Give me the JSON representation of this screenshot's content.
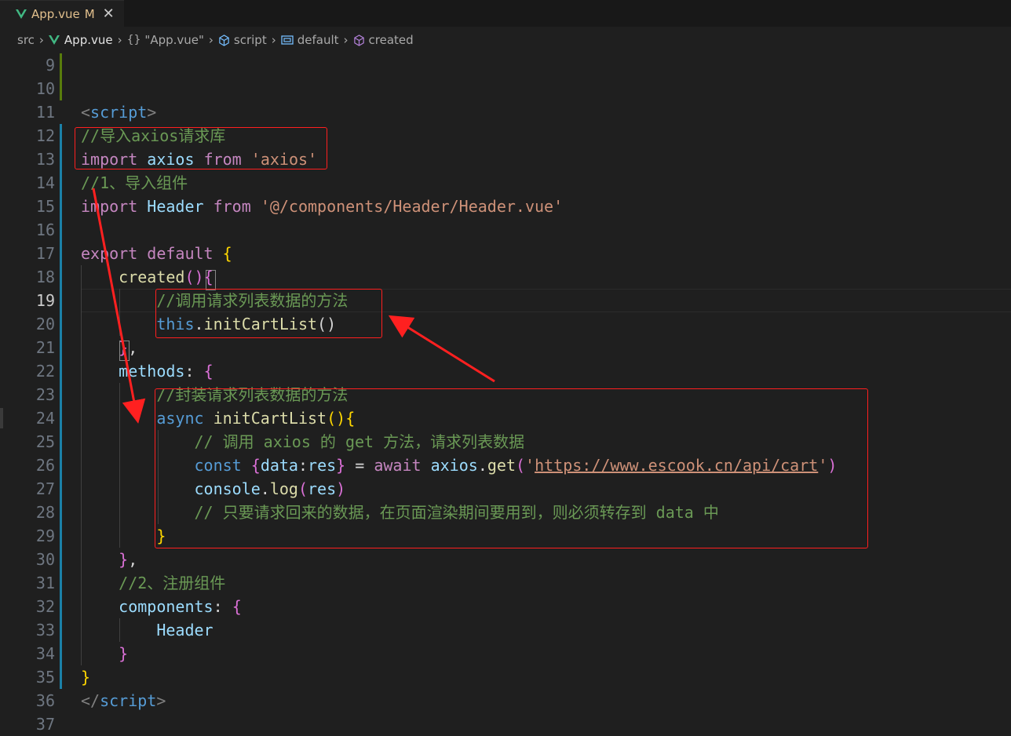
{
  "tab": {
    "filename": "App.vue",
    "status": "M",
    "icon": "vue-icon"
  },
  "breadcrumb": [
    {
      "label": "src",
      "icon": ""
    },
    {
      "label": "App.vue",
      "icon": "vue-icon"
    },
    {
      "label": "\"App.vue\"",
      "icon": "braces-icon"
    },
    {
      "label": "script",
      "icon": "cube-icon"
    },
    {
      "label": "default",
      "icon": "field-icon"
    },
    {
      "label": "created",
      "icon": "cube-icon"
    }
  ],
  "editor": {
    "active_line": 19,
    "lines": [
      {
        "n": "9",
        "tokens": []
      },
      {
        "n": "10",
        "tokens": []
      },
      {
        "n": "11",
        "tokens": [
          {
            "t": "<",
            "c": "tag"
          },
          {
            "t": "script",
            "c": "tagn"
          },
          {
            "t": ">",
            "c": "tag"
          }
        ]
      },
      {
        "n": "12",
        "tokens": [
          {
            "t": "//导入axios请求库",
            "c": "cm"
          }
        ]
      },
      {
        "n": "13",
        "tokens": [
          {
            "t": "import",
            "c": "kw"
          },
          {
            "t": " "
          },
          {
            "t": "axios",
            "c": "var"
          },
          {
            "t": " "
          },
          {
            "t": "from",
            "c": "kw"
          },
          {
            "t": " "
          },
          {
            "t": "'axios'",
            "c": "str"
          }
        ]
      },
      {
        "n": "14",
        "tokens": [
          {
            "t": "//1、导入组件",
            "c": "cm"
          }
        ]
      },
      {
        "n": "15",
        "tokens": [
          {
            "t": "import",
            "c": "kw"
          },
          {
            "t": " "
          },
          {
            "t": "Header",
            "c": "var"
          },
          {
            "t": " "
          },
          {
            "t": "from",
            "c": "kw"
          },
          {
            "t": " "
          },
          {
            "t": "'@/components/Header/Header.vue'",
            "c": "str"
          }
        ]
      },
      {
        "n": "16",
        "tokens": []
      },
      {
        "n": "17",
        "tokens": [
          {
            "t": "export",
            "c": "kw"
          },
          {
            "t": " "
          },
          {
            "t": "default",
            "c": "kw"
          },
          {
            "t": " "
          },
          {
            "t": "{",
            "c": "br1"
          }
        ]
      },
      {
        "n": "18",
        "tokens": [
          {
            "t": "    "
          },
          {
            "t": "created",
            "c": "fn"
          },
          {
            "t": "()",
            "c": "br2"
          },
          {
            "t": "{",
            "c": "br2"
          }
        ]
      },
      {
        "n": "19",
        "tokens": [
          {
            "t": "        "
          },
          {
            "t": "//调用请求列表数据的方法",
            "c": "cm"
          }
        ]
      },
      {
        "n": "20",
        "tokens": [
          {
            "t": "        "
          },
          {
            "t": "this",
            "c": "vb"
          },
          {
            "t": "."
          },
          {
            "t": "initCartList",
            "c": "fn"
          },
          {
            "t": "()"
          }
        ]
      },
      {
        "n": "21",
        "tokens": [
          {
            "t": "    "
          },
          {
            "t": "}",
            "c": "br2"
          },
          {
            "t": ","
          }
        ]
      },
      {
        "n": "22",
        "tokens": [
          {
            "t": "    "
          },
          {
            "t": "methods",
            "c": "var"
          },
          {
            "t": ": "
          },
          {
            "t": "{",
            "c": "br2"
          }
        ]
      },
      {
        "n": "23",
        "tokens": [
          {
            "t": "        "
          },
          {
            "t": "//封装请求列表数据的方法",
            "c": "cm"
          }
        ]
      },
      {
        "n": "24",
        "tokens": [
          {
            "t": "        "
          },
          {
            "t": "async",
            "c": "vb"
          },
          {
            "t": " "
          },
          {
            "t": "initCartList",
            "c": "fn"
          },
          {
            "t": "()",
            "c": "br1"
          },
          {
            "t": "{",
            "c": "br1"
          }
        ]
      },
      {
        "n": "25",
        "tokens": [
          {
            "t": "            "
          },
          {
            "t": "// 调用 axios 的 get 方法，请求列表数据",
            "c": "cm"
          }
        ]
      },
      {
        "n": "26",
        "tokens": [
          {
            "t": "            "
          },
          {
            "t": "const",
            "c": "vb"
          },
          {
            "t": " "
          },
          {
            "t": "{",
            "c": "br2"
          },
          {
            "t": "data",
            "c": "var"
          },
          {
            "t": ":"
          },
          {
            "t": "res",
            "c": "var"
          },
          {
            "t": "}",
            "c": "br2"
          },
          {
            "t": " = "
          },
          {
            "t": "await",
            "c": "kw"
          },
          {
            "t": " "
          },
          {
            "t": "axios",
            "c": "var"
          },
          {
            "t": "."
          },
          {
            "t": "get",
            "c": "fn"
          },
          {
            "t": "(",
            "c": "br2"
          },
          {
            "t": "'",
            "c": "str"
          },
          {
            "t": "https://www.escook.cn/api/cart",
            "c": "str url"
          },
          {
            "t": "'",
            "c": "str"
          },
          {
            "t": ")",
            "c": "br2"
          }
        ]
      },
      {
        "n": "27",
        "tokens": [
          {
            "t": "            "
          },
          {
            "t": "console",
            "c": "var"
          },
          {
            "t": "."
          },
          {
            "t": "log",
            "c": "fn"
          },
          {
            "t": "(",
            "c": "br2"
          },
          {
            "t": "res",
            "c": "var"
          },
          {
            "t": ")",
            "c": "br2"
          }
        ]
      },
      {
        "n": "28",
        "tokens": [
          {
            "t": "            "
          },
          {
            "t": "// 只要请求回来的数据，在页面渲染期间要用到，则必须转存到 data 中",
            "c": "cm"
          }
        ]
      },
      {
        "n": "29",
        "tokens": [
          {
            "t": "        "
          },
          {
            "t": "}",
            "c": "br1"
          }
        ]
      },
      {
        "n": "30",
        "tokens": [
          {
            "t": "    "
          },
          {
            "t": "}",
            "c": "br2"
          },
          {
            "t": ","
          }
        ]
      },
      {
        "n": "31",
        "tokens": [
          {
            "t": "    "
          },
          {
            "t": "//2、注册组件",
            "c": "cm"
          }
        ]
      },
      {
        "n": "32",
        "tokens": [
          {
            "t": "    "
          },
          {
            "t": "components",
            "c": "var"
          },
          {
            "t": ": "
          },
          {
            "t": "{",
            "c": "br2"
          }
        ]
      },
      {
        "n": "33",
        "tokens": [
          {
            "t": "        "
          },
          {
            "t": "Header",
            "c": "var"
          }
        ]
      },
      {
        "n": "34",
        "tokens": [
          {
            "t": "    "
          },
          {
            "t": "}",
            "c": "br2"
          }
        ]
      },
      {
        "n": "35",
        "tokens": [
          {
            "t": "}",
            "c": "br1"
          }
        ]
      },
      {
        "n": "36",
        "tokens": [
          {
            "t": "</",
            "c": "tag"
          },
          {
            "t": "script",
            "c": "tagn"
          },
          {
            "t": ">",
            "c": "tag"
          }
        ]
      },
      {
        "n": "37",
        "tokens": []
      }
    ]
  },
  "colors": {
    "highlight_box": "#ff1f1f",
    "arrow": "#ff2020",
    "git_added": "#587c0c",
    "git_modified": "#1b81a8"
  }
}
